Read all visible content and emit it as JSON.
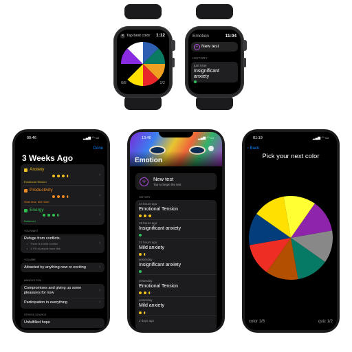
{
  "watch1": {
    "title": "Tap best color",
    "time": "1:12",
    "left_counter": "0/8",
    "right_counter": "1/2",
    "wheel_colors": [
      "#2e5fb0",
      "#0a7a62",
      "#f0a020",
      "#e8272b",
      "#ffe000",
      "#000000",
      "#8a2be2",
      "#ffffff"
    ]
  },
  "watch2": {
    "title": "Emotion",
    "time": "11:04",
    "new_test": "New test",
    "history_header": "HISTORY",
    "entry_time": "just now",
    "entry_title": "Insignificant anxiety"
  },
  "phone1": {
    "time": "00:46",
    "done": "Done",
    "title": "3 Weeks Ago",
    "rows": [
      {
        "name": "Anxiety",
        "sub": "Emotional Tension",
        "color": "#f0c020"
      },
      {
        "name": "Productivity",
        "sub": "Work less, rest more",
        "color": "#f08a20"
      },
      {
        "name": "Energy",
        "sub": "Balanced",
        "color": "#30c050"
      }
    ],
    "you_want_header": "YOU WANT",
    "you_want_title": "Refuge from conflicts.",
    "you_want_b1": "There is a mild conflict",
    "you_want_b2": "1.7% of people have this",
    "you_are_header": "YOU ARE",
    "you_are_value": "Attracted by anything new or exciting",
    "annoys_header": "ANNOYS YOU",
    "annoys_1a": "Compromises and giving up some",
    "annoys_1b": "pleasures for now",
    "annoys_2": "Participation in everything",
    "stress_header": "STRESS SOURCE",
    "stress_value": "Unfulfilled hope"
  },
  "phone2": {
    "time": "13:40",
    "title": "Emotion",
    "new_test": "New test",
    "new_test_sub": "Tap to begin the test",
    "history_header": "HISTORY",
    "entries": [
      {
        "when": "14 hours ago",
        "title": "Emotional Tension"
      },
      {
        "when": "19 hours ago",
        "title": "Insignificant anxiety"
      },
      {
        "when": "21 hours ago",
        "title": "Mild anxiety"
      },
      {
        "when": "yesterday",
        "title": "Insignificant anxiety"
      },
      {
        "when": "yesterday",
        "title": "Emotional Tension"
      },
      {
        "when": "yesterday",
        "title": "Mild anxiety"
      },
      {
        "when": "2 days ago",
        "title": ""
      }
    ]
  },
  "phone3": {
    "time": "01:19",
    "back": "Back",
    "heading": "Pick your next color",
    "left_counter": "color 1/8",
    "right_counter": "quiz 1/2",
    "wheel_colors": [
      "#ffff33",
      "#8e24aa",
      "#888888",
      "#077a66",
      "#b24f00",
      "#ee2e24",
      "#033d7a",
      "#ffe000"
    ]
  },
  "accent": "#0a84ff"
}
